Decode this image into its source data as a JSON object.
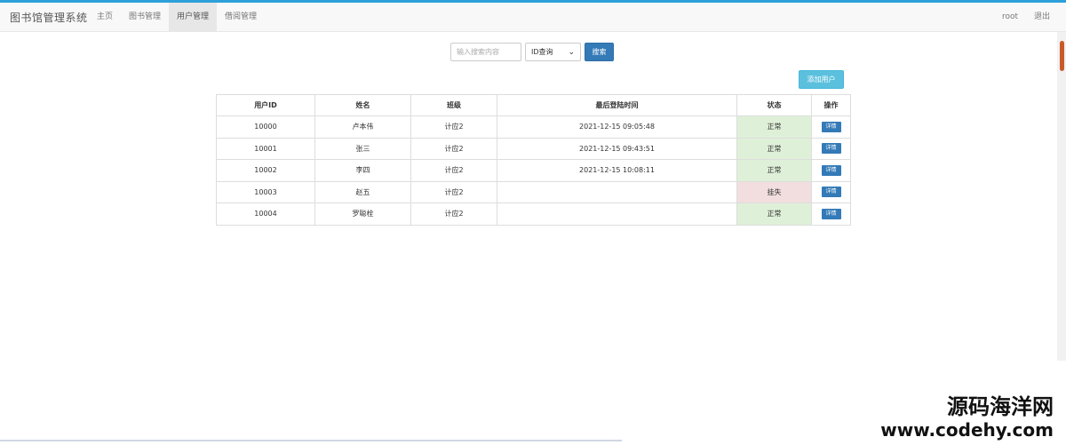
{
  "nav": {
    "brand": "图书馆管理系统",
    "items": [
      {
        "label": "主页"
      },
      {
        "label": "图书管理"
      },
      {
        "label": "用户管理"
      },
      {
        "label": "借阅管理"
      }
    ],
    "user": "root",
    "logout": "退出"
  },
  "search": {
    "placeholder": "输入搜索内容",
    "select_value": "ID查询",
    "button": "搜索"
  },
  "add_user_button": "添加用户",
  "table": {
    "headers": [
      "用户ID",
      "姓名",
      "班级",
      "最后登陆时间",
      "状态",
      "操作"
    ],
    "rows": [
      {
        "id": "10000",
        "name": "卢本伟",
        "class": "计应2",
        "last_login": "2021-12-15 09:05:48",
        "status": "正常",
        "action": "详情"
      },
      {
        "id": "10001",
        "name": "张三",
        "class": "计应2",
        "last_login": "2021-12-15 09:43:51",
        "status": "正常",
        "action": "详情"
      },
      {
        "id": "10002",
        "name": "李四",
        "class": "计应2",
        "last_login": "2021-12-15 10:08:11",
        "status": "正常",
        "action": "详情"
      },
      {
        "id": "10003",
        "name": "赵五",
        "class": "计应2",
        "last_login": "",
        "status": "挂失",
        "action": "详情"
      },
      {
        "id": "10004",
        "name": "罗聪栓",
        "class": "计应2",
        "last_login": "",
        "status": "正常",
        "action": "详情"
      }
    ]
  },
  "watermark": {
    "cn": "源码海洋网",
    "url": "www.codehy.com"
  },
  "colors": {
    "primary": "#337ab7",
    "info": "#5bc0de",
    "status_normal_bg": "#dff0d8",
    "status_lost_bg": "#f2dede"
  }
}
